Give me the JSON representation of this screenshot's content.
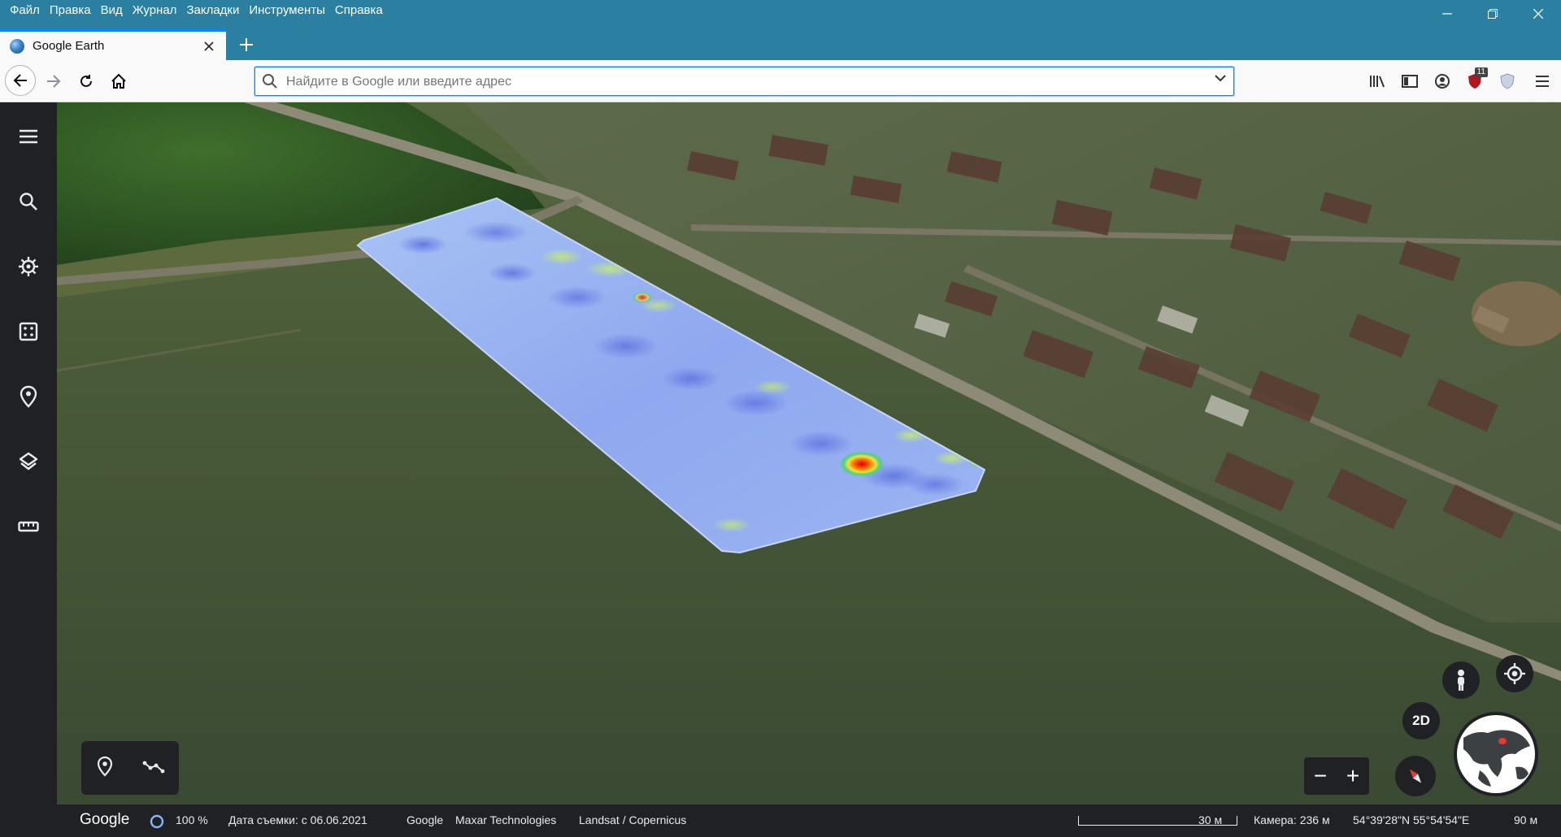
{
  "menubar": {
    "items": [
      "Файл",
      "Правка",
      "Вид",
      "Журнал",
      "Закладки",
      "Инструменты",
      "Справка"
    ]
  },
  "tab": {
    "title": "Google Earth"
  },
  "urlbar": {
    "placeholder": "Найдите в Google или введите адрес"
  },
  "toolbar": {
    "extension_badge": "11"
  },
  "earth": {
    "sidebar_icons": [
      "menu-icon",
      "search-icon",
      "voyager-icon",
      "feeling-lucky-icon",
      "projects-icon",
      "layers-icon",
      "measure-icon"
    ],
    "controls": {
      "view_2d_label": "2D",
      "zoom_out": "−",
      "zoom_in": "+"
    },
    "status": {
      "logo": "Google",
      "loading_percent": "100 %",
      "capture_date": "Дата съемки: с 06.06.2021",
      "credit_google": "Google",
      "credit_maxar": "Maxar Technologies",
      "credit_landsat": "Landsat / Copernicus",
      "scale": "30 м",
      "camera": "Камера: 236 м",
      "coordinates": "54°39'28\"N 55°54'54\"E",
      "elevation": "90 м"
    }
  },
  "colors": {
    "firefox_chrome": "#2b7fa0",
    "earth_dark": "#202124",
    "overlay_low": "#8fa8ef",
    "overlay_high": "#d90000"
  }
}
